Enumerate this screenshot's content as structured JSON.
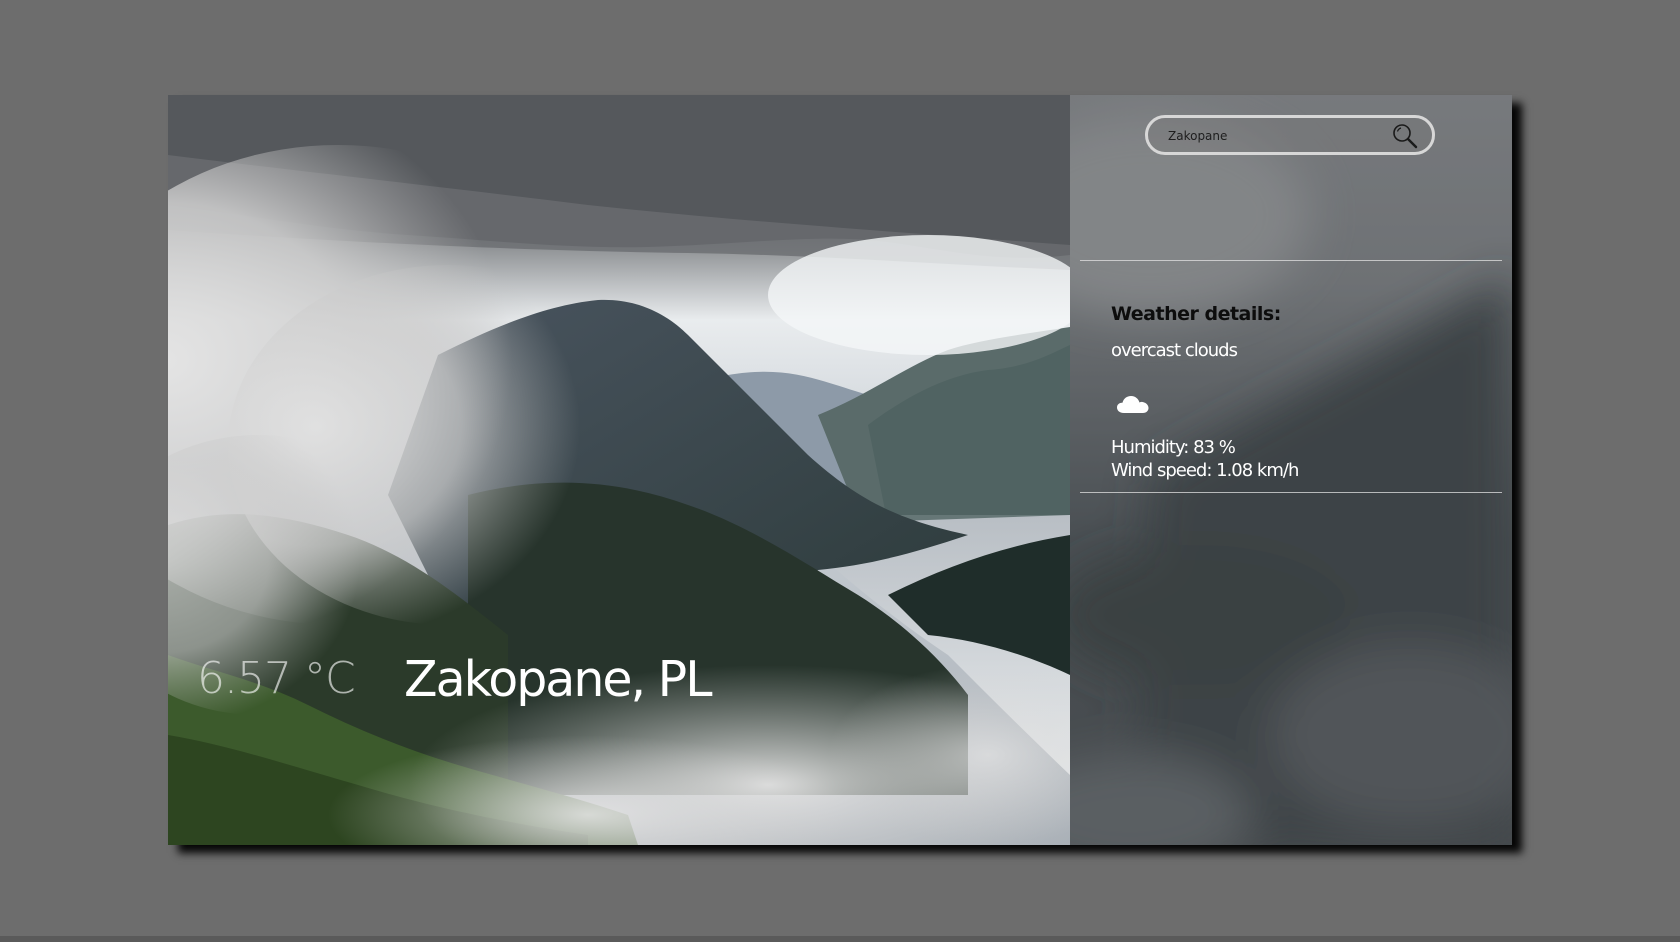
{
  "search": {
    "value": "Zakopane",
    "button_icon": "search-icon"
  },
  "current": {
    "temperature": "6.57 °C",
    "location": "Zakopane, PL"
  },
  "details": {
    "title": "Weather details:",
    "description": "overcast clouds",
    "icon": "cloud-icon",
    "humidity": "Humidity: 83 %",
    "wind_speed": "Wind speed: 1.08 km/h"
  },
  "colors": {
    "page_background": "#6d6d6d",
    "text_primary": "#ffffff",
    "details_title": "#0d0d0d",
    "search_border": "#d7d7d7"
  }
}
